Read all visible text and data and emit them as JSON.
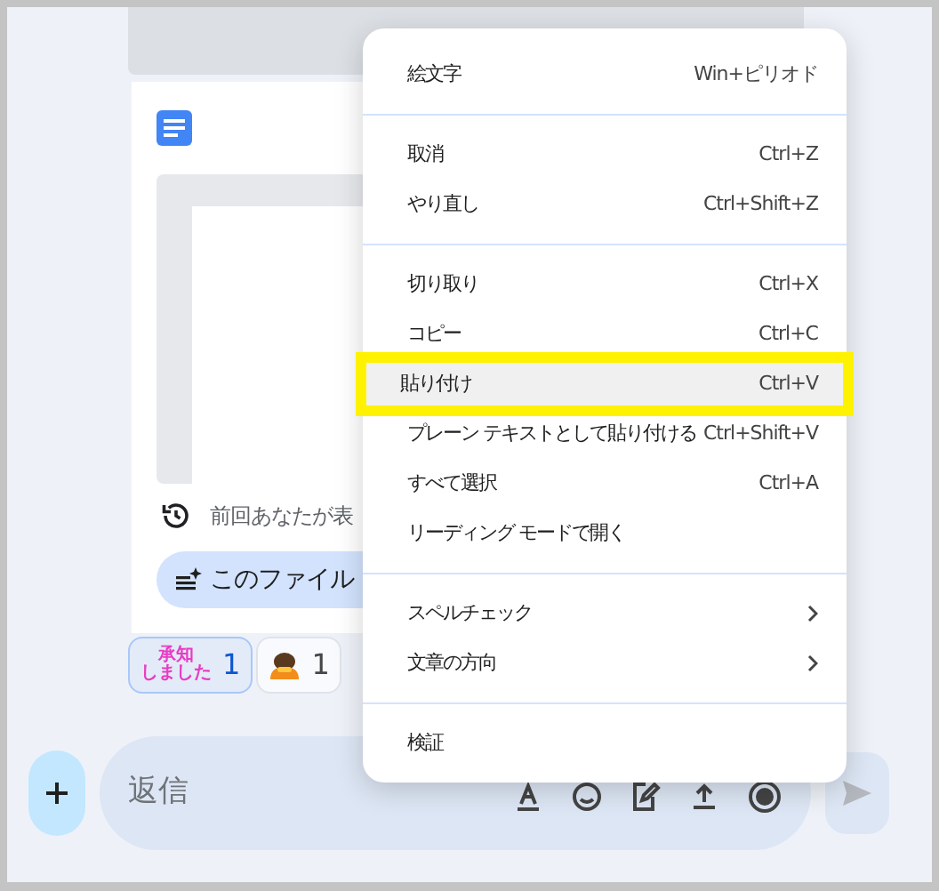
{
  "file_card": {
    "history_text": "前回あなたが表",
    "action_chip": "このファイル"
  },
  "reactions": [
    {
      "kind": "sticker",
      "lines": [
        "承知",
        "しました"
      ],
      "count": "1",
      "selected": true
    },
    {
      "kind": "emoji",
      "count": "1",
      "selected": false
    }
  ],
  "composer": {
    "placeholder": "返信"
  },
  "context_menu": {
    "groups": [
      [
        {
          "label": "絵文字",
          "shortcut": "Win+ピリオド",
          "submenu": false,
          "selected": false
        }
      ],
      [
        {
          "label": "取消",
          "shortcut": "Ctrl+Z",
          "submenu": false,
          "selected": false
        },
        {
          "label": "やり直し",
          "shortcut": "Ctrl+Shift+Z",
          "submenu": false,
          "selected": false
        }
      ],
      [
        {
          "label": "切り取り",
          "shortcut": "Ctrl+X",
          "submenu": false,
          "selected": false
        },
        {
          "label": "コピー",
          "shortcut": "Ctrl+C",
          "submenu": false,
          "selected": false
        },
        {
          "label": "貼り付け",
          "shortcut": "Ctrl+V",
          "submenu": false,
          "selected": true
        },
        {
          "label": "プレーン テキストとして貼り付ける",
          "shortcut": "Ctrl+Shift+V",
          "submenu": false,
          "selected": false
        },
        {
          "label": "すべて選択",
          "shortcut": "Ctrl+A",
          "submenu": false,
          "selected": false
        },
        {
          "label": "リーディング モードで開く",
          "submenu": false,
          "selected": false
        }
      ],
      [
        {
          "label": "スペルチェック",
          "submenu": true,
          "selected": false
        },
        {
          "label": "文章の方向",
          "submenu": true,
          "selected": false
        }
      ],
      [
        {
          "label": "検証",
          "submenu": false,
          "selected": false
        }
      ]
    ]
  }
}
